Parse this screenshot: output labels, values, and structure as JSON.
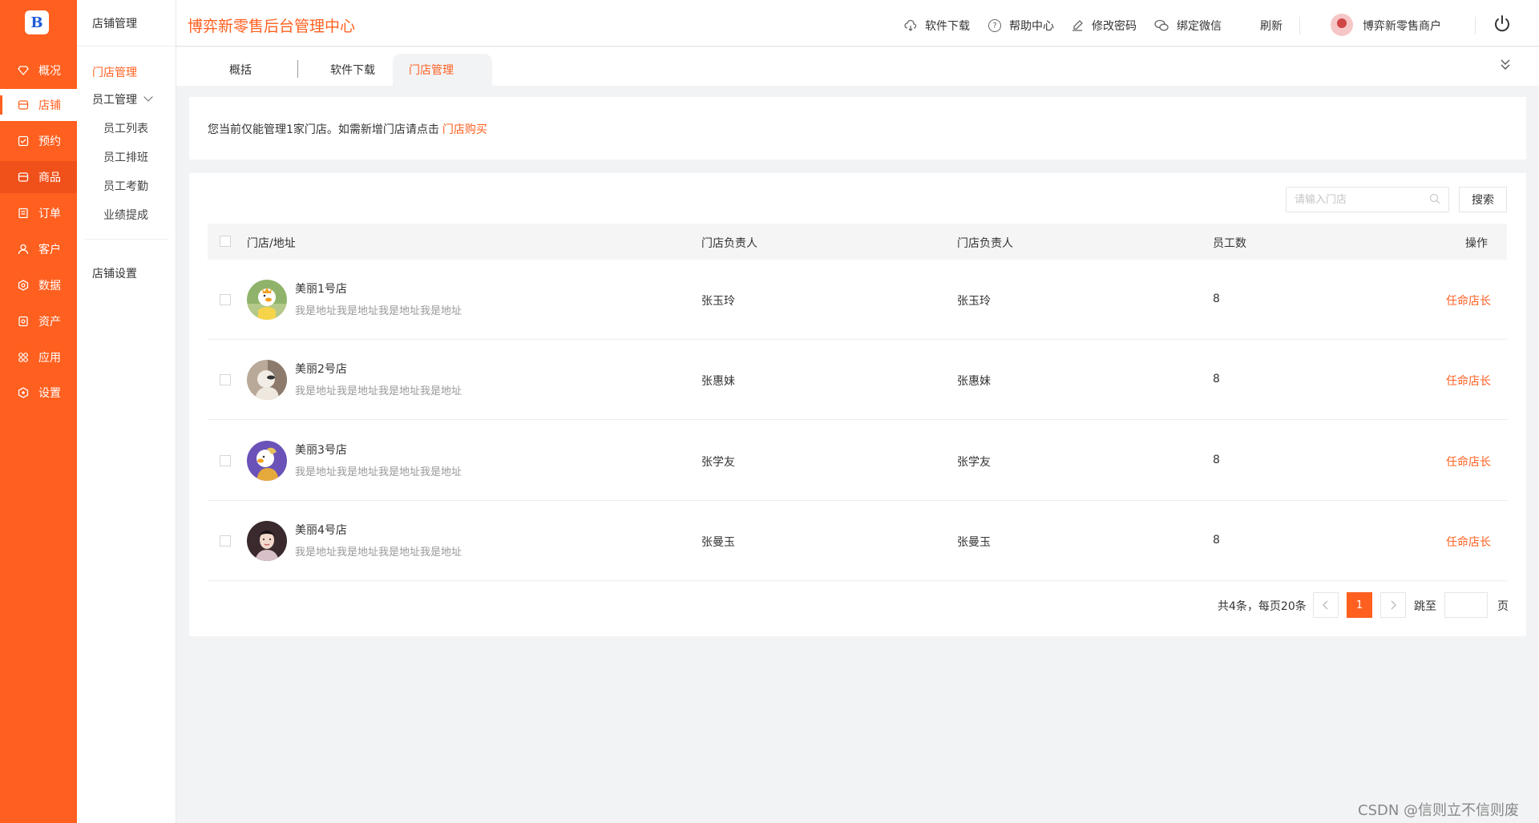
{
  "app": {
    "title": "博弈新零售后台管理中心",
    "logo_glyph": "B"
  },
  "rail": {
    "items": [
      {
        "label": "概况",
        "icon": "diamond-icon"
      },
      {
        "label": "店铺",
        "icon": "store-icon"
      },
      {
        "label": "预约",
        "icon": "calendar-icon"
      },
      {
        "label": "商品",
        "icon": "goods-icon"
      },
      {
        "label": "订单",
        "icon": "order-icon"
      },
      {
        "label": "客户",
        "icon": "user-icon"
      },
      {
        "label": "数据",
        "icon": "data-icon"
      },
      {
        "label": "资产",
        "icon": "asset-icon"
      },
      {
        "label": "应用",
        "icon": "apps-icon"
      },
      {
        "label": "设置",
        "icon": "settings-icon"
      }
    ],
    "active_index": 1
  },
  "side": {
    "heading": "店铺管理",
    "store_mgmt": "门店管理",
    "staff_mgmt": "员工管理",
    "staff_items": [
      "员工列表",
      "员工排班",
      "员工考勤",
      "业绩提成"
    ],
    "shop_settings": "店铺设置"
  },
  "header": {
    "download": "软件下载",
    "help": "帮助中心",
    "change_pwd": "修改密码",
    "bind_wechat": "绑定微信",
    "refresh": "刷新",
    "username": "博弈新零售商户"
  },
  "tabs": [
    "概括",
    "软件下载",
    "门店管理"
  ],
  "notice": {
    "text": "您当前仅能管理1家门店。如需新增门店请点击",
    "link": "门店购买"
  },
  "search": {
    "placeholder": "请输入门店",
    "button": "搜索"
  },
  "table": {
    "headers": [
      "门店/地址",
      "门店负责人",
      "门店负责人",
      "员工数",
      "操作"
    ],
    "rows": [
      {
        "name": "美丽1号店",
        "address": "我是地址我是地址我是地址我是地址",
        "owner1": "张玉玲",
        "owner2": "张玉玲",
        "staff": "8",
        "action": "任命店长"
      },
      {
        "name": "美丽2号店",
        "address": "我是地址我是地址我是地址我是地址",
        "owner1": "张惠妹",
        "owner2": "张惠妹",
        "staff": "8",
        "action": "任命店长"
      },
      {
        "name": "美丽3号店",
        "address": "我是地址我是地址我是地址我是地址",
        "owner1": "张学友",
        "owner2": "张学友",
        "staff": "8",
        "action": "任命店长"
      },
      {
        "name": "美丽4号店",
        "address": "我是地址我是地址我是地址我是地址",
        "owner1": "张曼玉",
        "owner2": "张曼玉",
        "staff": "8",
        "action": "任命店长"
      }
    ]
  },
  "pagination": {
    "summary": "共4条，每页20条",
    "current": "1",
    "jump_label": "跳至",
    "page_label": "页"
  },
  "watermark": "CSDN @信则立不信则废",
  "colors": {
    "brand": "#ff5f1f",
    "rail_dark": "#f0501a",
    "bg": "#f2f3f5"
  }
}
